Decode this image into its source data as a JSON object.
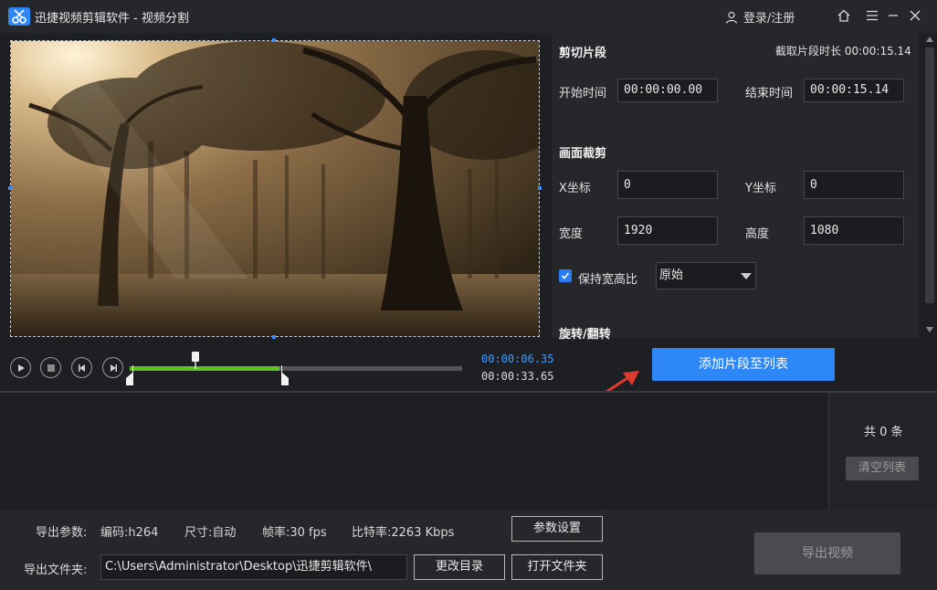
{
  "window": {
    "title": "迅捷视频剪辑软件 - 视频分割",
    "login": "登录/注册"
  },
  "player": {
    "current_time": "00:00:06.35",
    "total_time": "00:00:33.65",
    "played_fraction": 0.45
  },
  "cut": {
    "title": "剪切片段",
    "duration_label": "截取片段时长 00:00:15.14",
    "start_label": "开始时间",
    "start_value": "00:00:00.00",
    "end_label": "结束时间",
    "end_value": "00:00:15.14"
  },
  "crop": {
    "title": "画面裁剪",
    "x_label": "X坐标",
    "x_value": "0",
    "y_label": "Y坐标",
    "y_value": "0",
    "width_label": "宽度",
    "width_value": "1920",
    "height_label": "高度",
    "height_value": "1080",
    "keep_ratio_label": "保持宽高比",
    "ratio_value": "原始"
  },
  "rotate": {
    "title": "旋转/翻转"
  },
  "actions": {
    "add_label": "添加片段至列表",
    "count_label": "共 0 条",
    "clear_label": "清空列表"
  },
  "export": {
    "params_label": "导出参数:",
    "codec": "编码:h264",
    "size": "尺寸:自动",
    "fps": "帧率:30 fps",
    "bitrate": "比特率:2263 Kbps",
    "settings_label": "参数设置",
    "folder_label": "导出文件夹:",
    "folder_path": "C:\\Users\\Administrator\\Desktop\\迅捷剪辑软件\\",
    "change_dir_label": "更改目录",
    "open_folder_label": "打开文件夹",
    "export_label": "导出视频"
  },
  "colors": {
    "accent": "#2e87f7",
    "progress": "#5fc31f",
    "arrow": "#e03a2f"
  }
}
